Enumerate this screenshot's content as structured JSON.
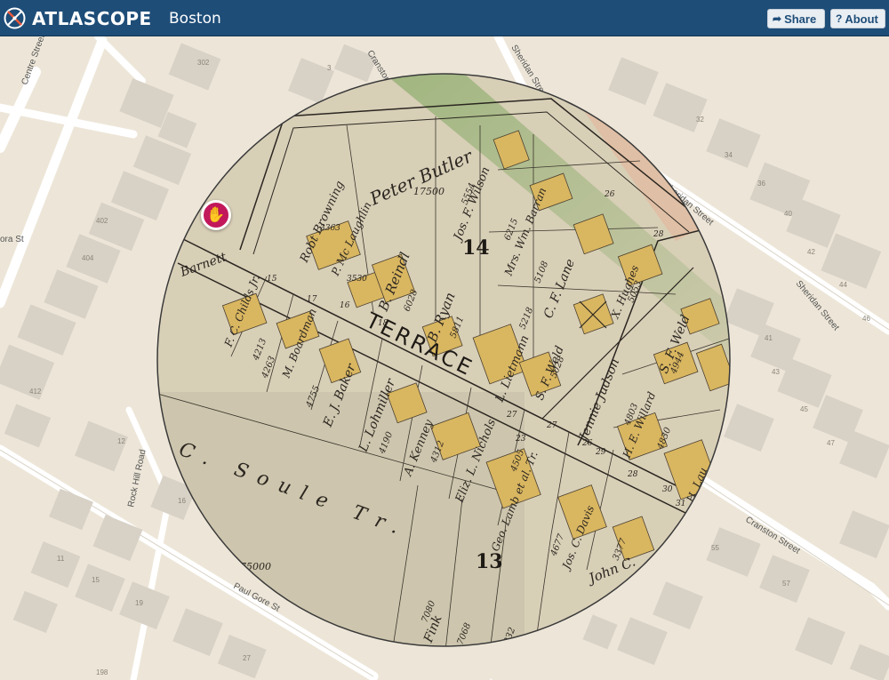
{
  "header": {
    "brand": "ATLASCOPE",
    "city": "Boston",
    "share_label": "Share",
    "about_label": "About"
  },
  "icons": {
    "logo": "compass-logo-icon",
    "share": "share-icon",
    "about": "question-icon",
    "lens_handle": "hand-icon",
    "cursor": "mouse-pointer-icon"
  },
  "colors": {
    "header_bg": "#1e4d78",
    "map_bg": "#ede6d8",
    "building": "#d6cfc4",
    "lens_handle": "#c2185b",
    "atlas_paper": "#d9d0b8",
    "atlas_building": "#d6b45e"
  },
  "basemap": {
    "streets": [
      "Centre Street",
      "Cranston Street",
      "Sheridan Street",
      "Rock Hill Road",
      "Paul Gore St",
      "Cranston Street"
    ],
    "partial_labels": [
      "ora St"
    ],
    "lot_numbers": [
      "302",
      "3",
      "32",
      "34",
      "36",
      "40",
      "42",
      "44",
      "46",
      "402",
      "404",
      "412",
      "12",
      "16",
      "11",
      "15",
      "19",
      "27",
      "31",
      "41",
      "43",
      "45",
      "47",
      "49",
      "55",
      "57",
      "18",
      "198"
    ]
  },
  "atlas": {
    "blocks": [
      "14",
      "13"
    ],
    "streets": [
      "TERRACE",
      "C. Soule Tr.",
      "Soule Tr."
    ],
    "owners": [
      "Peter Butler",
      "Robt Browning",
      "P. Mc Laughlin",
      "B. Reindl",
      "Jos. F. Wilson",
      "Mrs. Wm. Barran",
      "C. F. Lane",
      "B. Ryan",
      "L. Lietmann",
      "S. F. Weld",
      "X. Hughes",
      "S. F. Weld",
      "F. C. Childs Jr.",
      "M. Boardman",
      "E. J. Baker",
      "L. Lohmiller",
      "A. Kenney",
      "Eliz. L. Nichols",
      "Geo. Lamb et al. Tr.",
      "Jos. C. Davis",
      "John C.",
      "Jennie Judson",
      "H. E. Willard",
      "H. Lau",
      "Ilona Fink",
      "Barnett"
    ],
    "areas": [
      "17500",
      "5554",
      "6215",
      "3363",
      "3530",
      "6028",
      "5811",
      "5108",
      "5218",
      "5028",
      "5053",
      "4944",
      "4213",
      "4263",
      "4755",
      "4190",
      "4312",
      "4505",
      "4677",
      "4803",
      "4830",
      "3377",
      "75000",
      "7080",
      "7068",
      "7032"
    ],
    "lot_numbers": [
      "27",
      "28",
      "29",
      "30",
      "31",
      "15",
      "16",
      "17",
      "18",
      "26",
      "25",
      "24"
    ]
  }
}
